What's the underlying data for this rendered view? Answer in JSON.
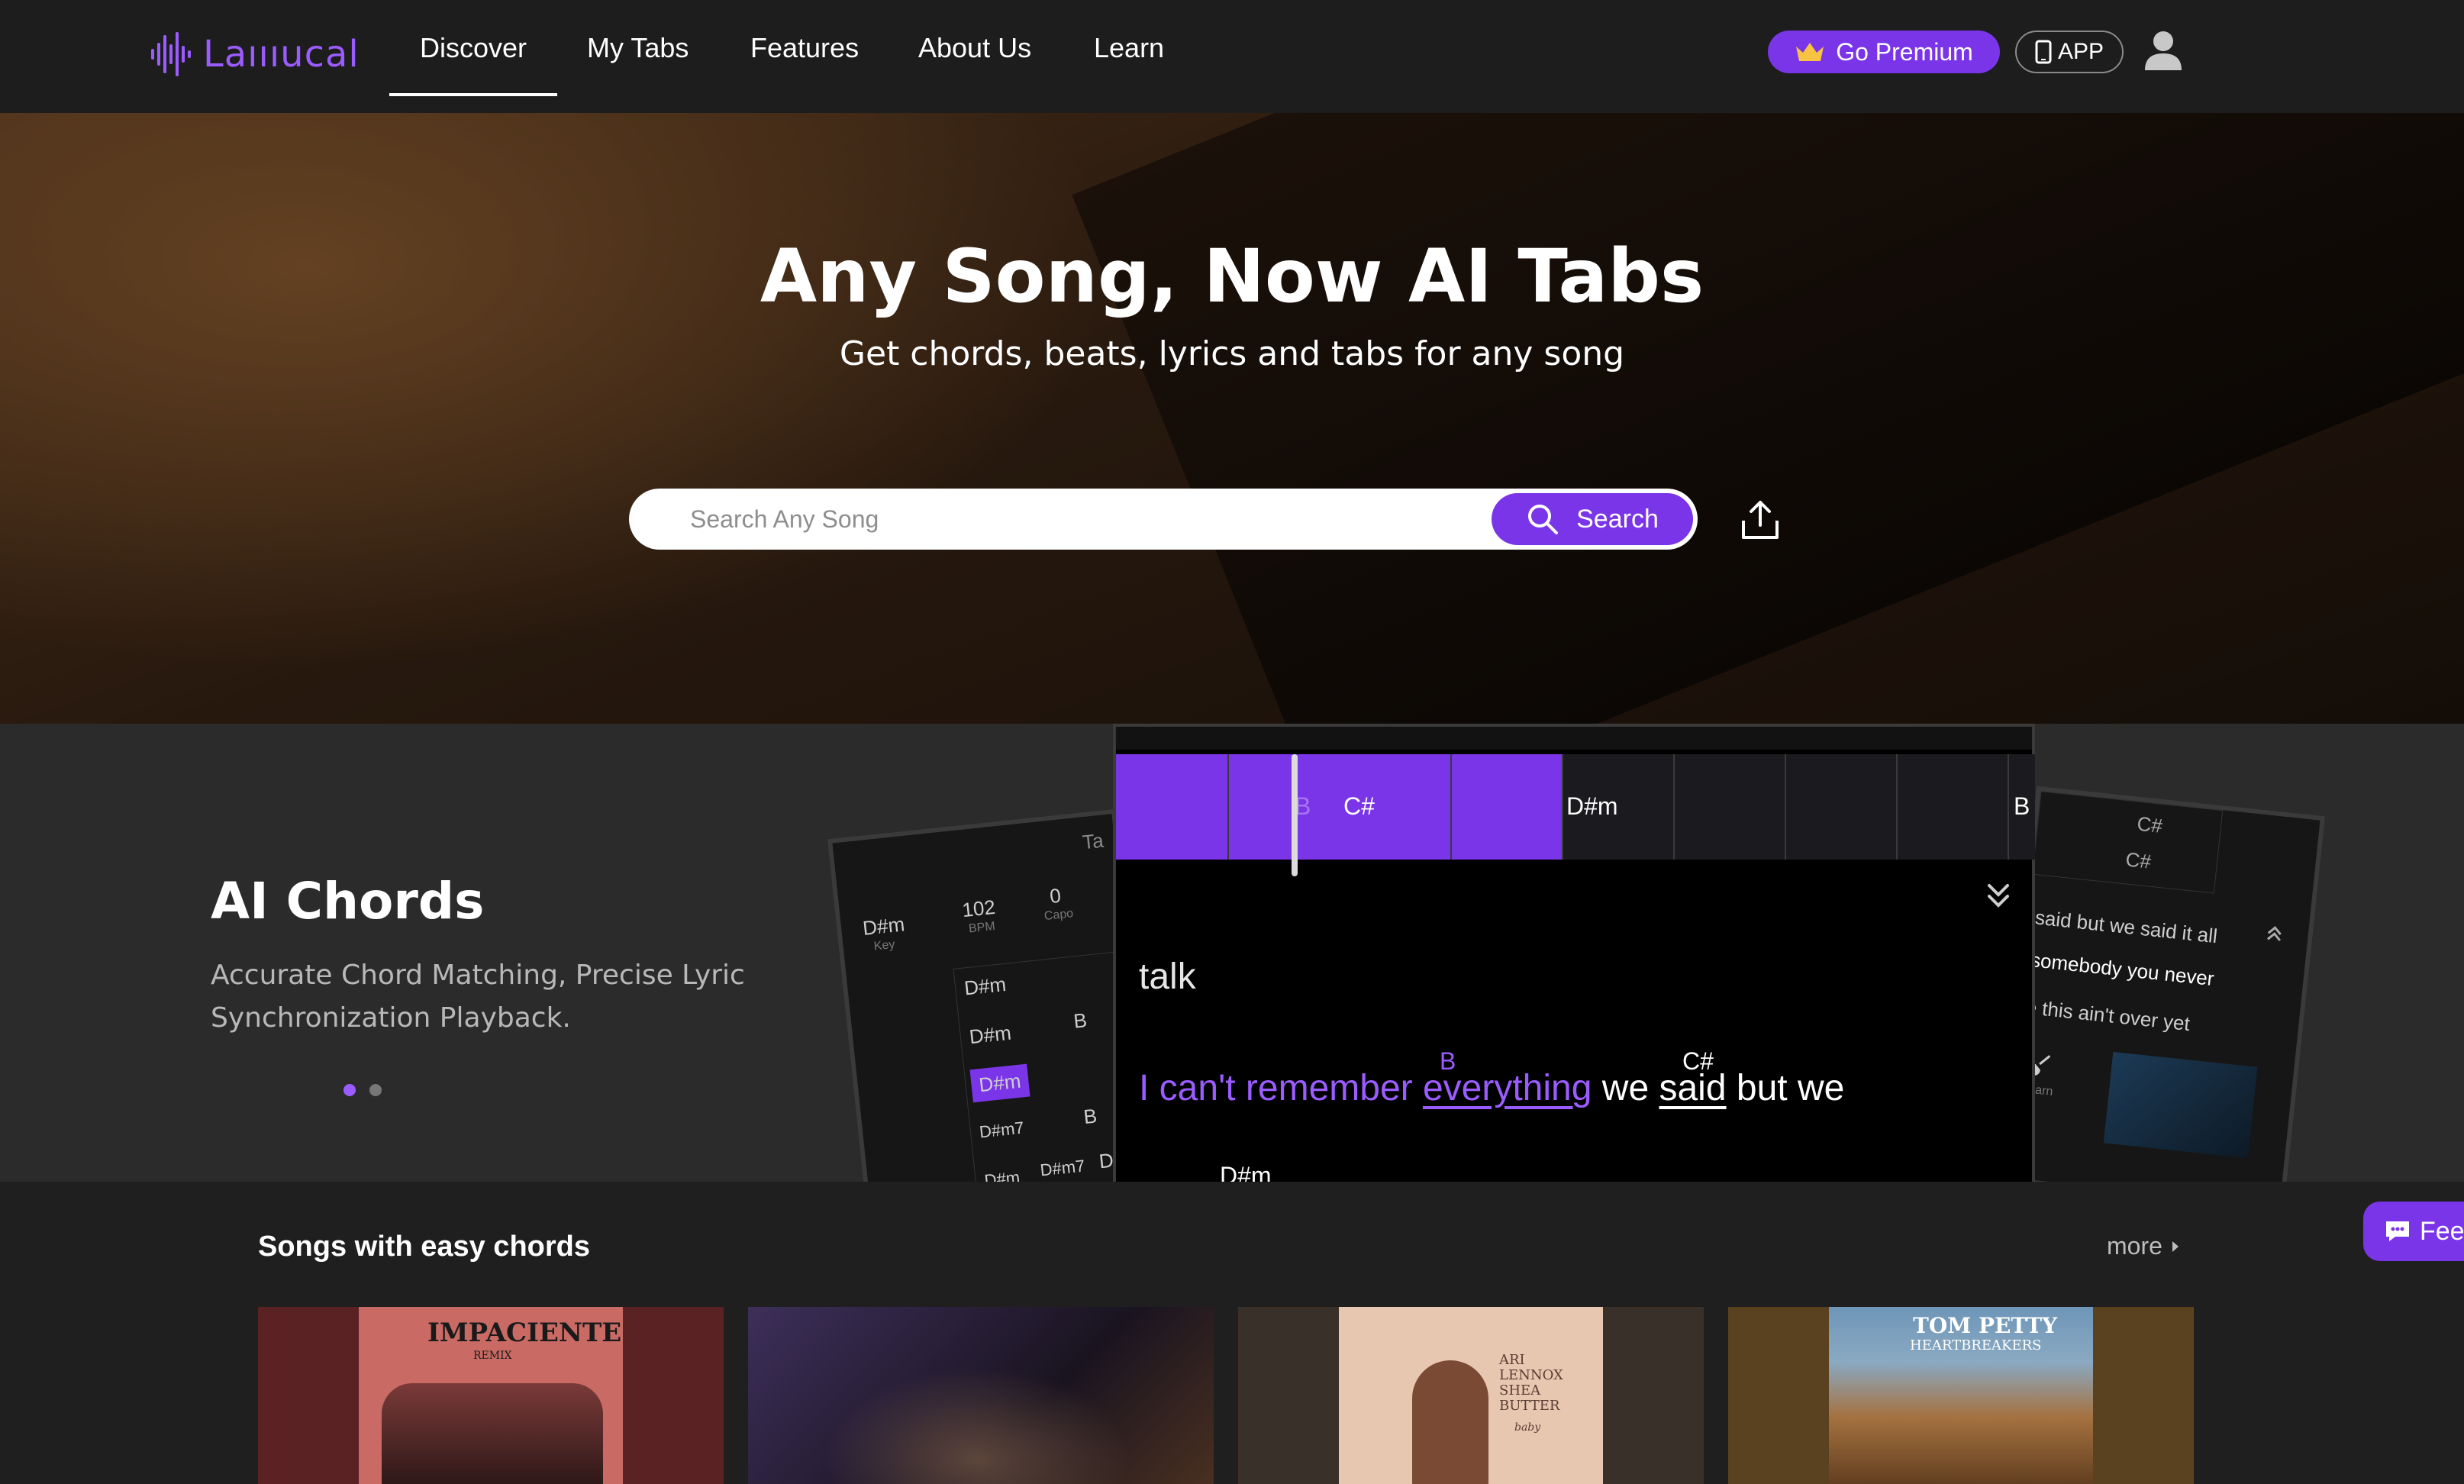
{
  "nav": {
    "logo_text": "Laıııucal",
    "items": [
      {
        "label": "Discover"
      },
      {
        "label": "My Tabs"
      },
      {
        "label": "Features"
      },
      {
        "label": "About Us"
      },
      {
        "label": "Learn"
      }
    ],
    "premium_label": "Go Premium",
    "app_label": "APP",
    "icons": {
      "logo": "soundwave-logo-icon",
      "premium": "crown-icon",
      "app": "phone-icon",
      "user": "user-icon"
    }
  },
  "hero": {
    "title": "Any Song, Now AI Tabs",
    "subtitle": "Get chords, beats, lyrics and tabs for any song",
    "search": {
      "placeholder": "Search Any Song",
      "button_label": "Search"
    }
  },
  "feature": {
    "title": "AI Chords",
    "description": "Accurate Chord Matching, Precise Lyric Synchronization Playback.",
    "carousel": {
      "active_index": 0,
      "count": 2
    },
    "preview": {
      "left": {
        "tab": "Ta",
        "key_value": "D#m",
        "key_label": "Key",
        "bpm_value": "102",
        "bpm_label": "BPM",
        "capo_value": "0",
        "capo_label": "Capo",
        "chords": [
          "D#m",
          "D#m",
          "B",
          "D#m",
          "D#m7",
          "B",
          "D#m",
          "D#m7",
          "D"
        ]
      },
      "main": {
        "cells": [
          "",
          "",
          "B",
          "C#",
          "",
          "D#m",
          "",
          "",
          "",
          "B"
        ],
        "lyric_prev": "talk",
        "line_words": [
          "I can't remember",
          "everything",
          "we",
          "said",
          "but we"
        ],
        "chord_b": "B",
        "chord_cs": "C#",
        "next_chord": "D#m"
      },
      "right": {
        "chords": [
          "C#",
          "C#"
        ],
        "line1": "said but we said it all",
        "line2": "somebody you never",
        "line3": "e this ain't over yet",
        "learn_label": "Learn"
      }
    }
  },
  "songs": {
    "title": "Songs with easy chords",
    "more_label": "more",
    "cards": [
      {
        "art_title": "IMPACIENTE",
        "art_sub": "REMIX"
      },
      {
        "art_title": "",
        "art_sub": ""
      },
      {
        "art_title": "ARI LENNOX SHEA BUTTER",
        "art_sub": "baby"
      },
      {
        "art_title": "TOM PETTY",
        "art_sub": "HEARTBREAKERS"
      }
    ]
  },
  "feedback": {
    "label": "Fee"
  },
  "colors": {
    "accent": "#7b35e8",
    "accent_light": "#9b5cff",
    "nav_bg": "#1d1d1d",
    "band_bg": "#2b2b2b"
  }
}
